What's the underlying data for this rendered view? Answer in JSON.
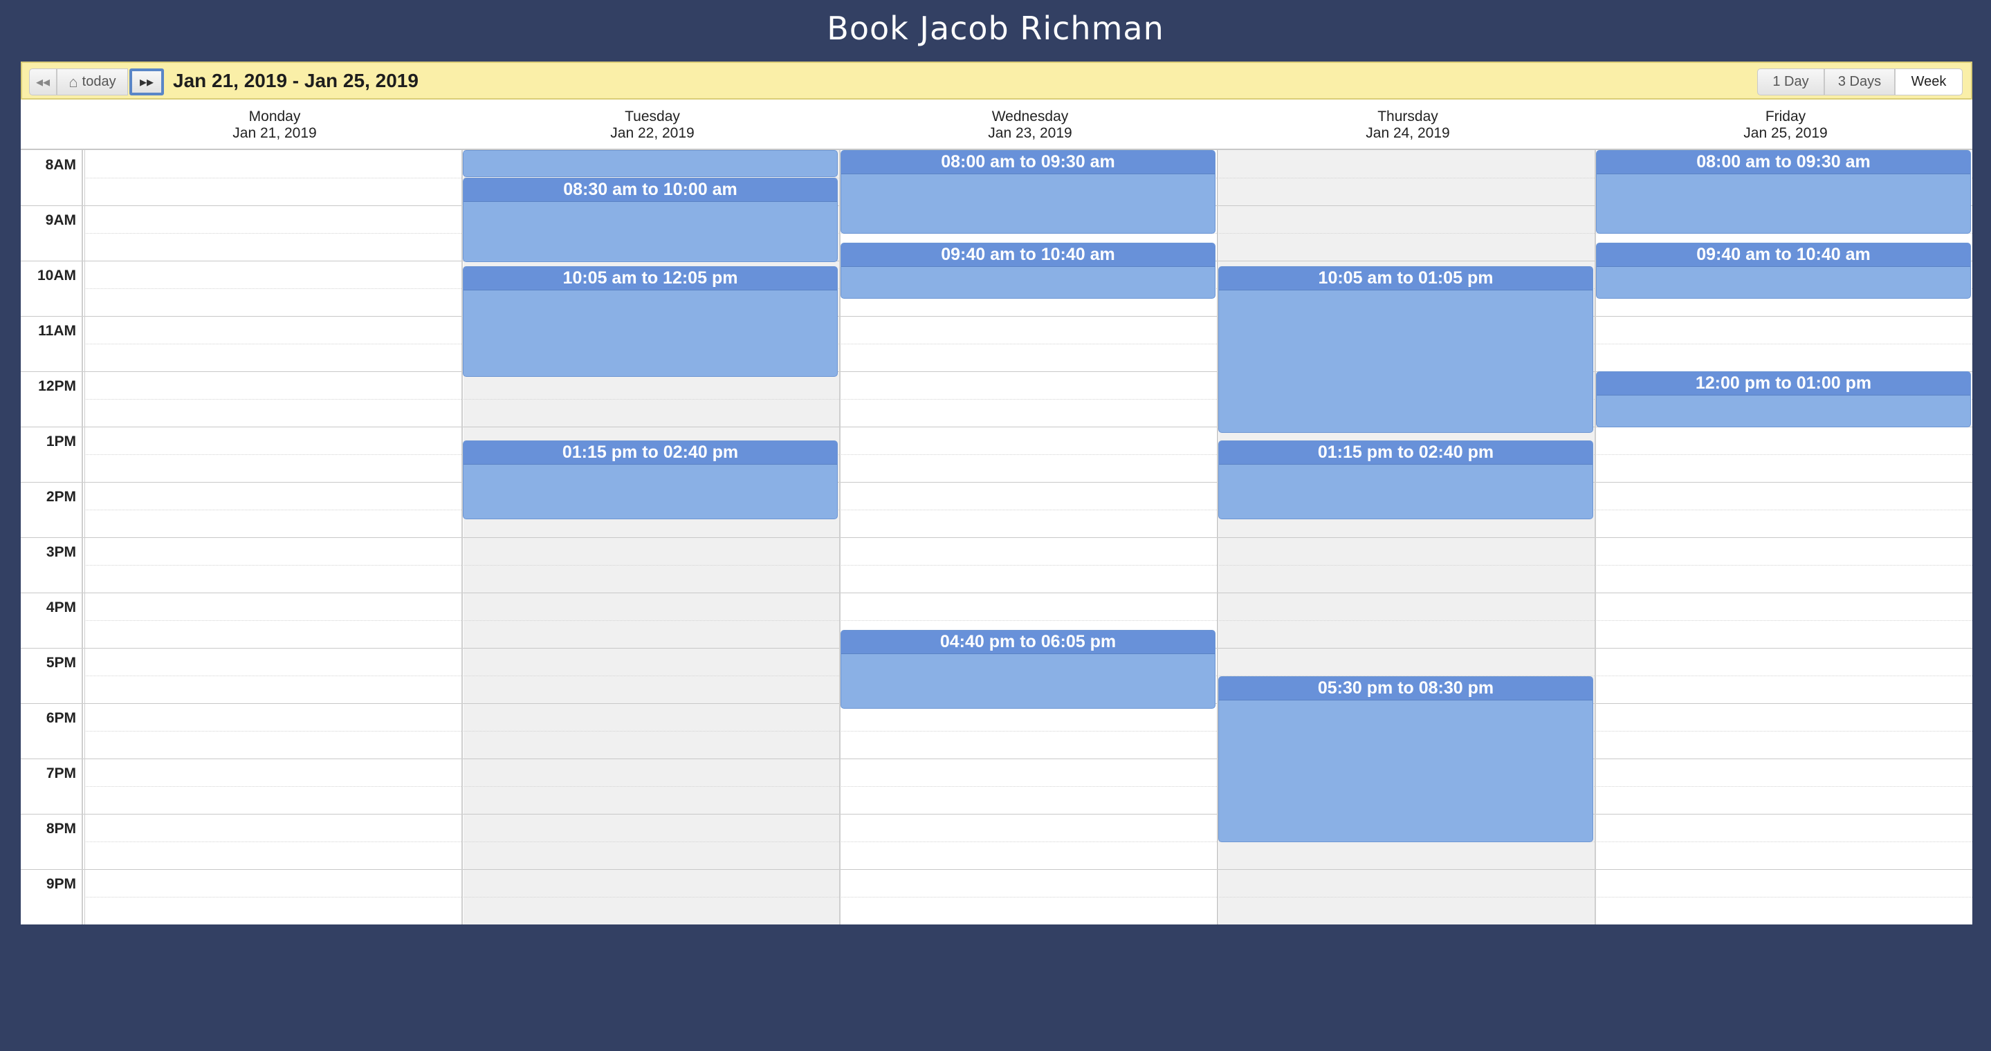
{
  "page": {
    "title": "Book Jacob Richman"
  },
  "toolbar": {
    "prev_icon": "◂◂",
    "today_label": "today",
    "home_icon": "⌂",
    "next_icon": "▸▸",
    "date_range": "Jan 21, 2019 - Jan 25, 2019",
    "views": {
      "day": "1 Day",
      "three_days": "3 Days",
      "week": "Week"
    },
    "active_view": "Week"
  },
  "days": [
    {
      "name": "Monday",
      "date": "Jan 21, 2019"
    },
    {
      "name": "Tuesday",
      "date": "Jan 22, 2019"
    },
    {
      "name": "Wednesday",
      "date": "Jan 23, 2019"
    },
    {
      "name": "Thursday",
      "date": "Jan 24, 2019"
    },
    {
      "name": "Friday",
      "date": "Jan 25, 2019"
    }
  ],
  "hours": [
    "8AM",
    "9AM",
    "10AM",
    "11AM",
    "12PM",
    "1PM",
    "2PM",
    "3PM",
    "4PM",
    "5PM",
    "6PM",
    "7PM",
    "8PM",
    "9PM"
  ],
  "events": {
    "tue_0": {
      "label": ""
    },
    "tue_1": {
      "label": "08:30 am to 10:00 am"
    },
    "tue_2": {
      "label": "10:05 am to 12:05 pm"
    },
    "tue_3": {
      "label": "01:15 pm to 02:40 pm"
    },
    "wed_1": {
      "label": "08:00 am to 09:30 am"
    },
    "wed_2": {
      "label": "09:40 am to 10:40 am"
    },
    "wed_3": {
      "label": "04:40 pm to 06:05 pm"
    },
    "thu_1": {
      "label": "10:05 am to 01:05 pm"
    },
    "thu_2": {
      "label": "01:15 pm to 02:40 pm"
    },
    "thu_3": {
      "label": "05:30 pm to 08:30 pm"
    },
    "fri_1": {
      "label": "08:00 am to 09:30 am"
    },
    "fri_2": {
      "label": "09:40 am to 10:40 am"
    },
    "fri_3": {
      "label": "12:00 pm to 01:00 pm"
    }
  },
  "colors": {
    "background": "#334063",
    "toolbar": "#faefa8",
    "event": "#8ab0e5",
    "event_header": "#6891d9",
    "unavailable": "#f0f0f0"
  }
}
